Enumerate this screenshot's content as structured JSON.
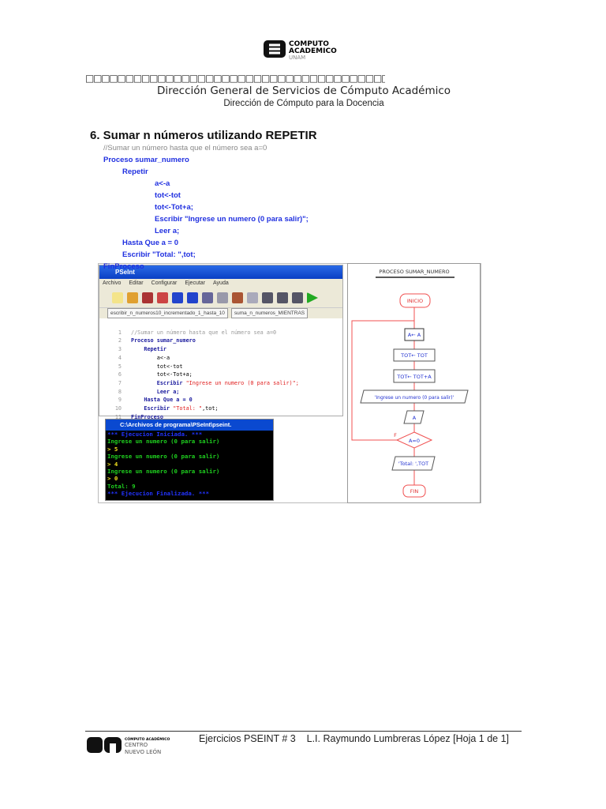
{
  "header": {
    "logo_lines": [
      "COMPUTO",
      "ACADEMICO",
      "UNAM"
    ],
    "boxes": "□□□□□□□□□□□□□□□□□□□□□□□□□□□□□□□□□□□□□□□□□□□□□□□□□□□□□□□□□□□□□□□□",
    "line1": "Dirección General de Servicios de Cómputo Académico",
    "line2": "Dirección de Cómputo para la Docencia"
  },
  "section": {
    "title": "6. Sumar n números utilizando REPETIR",
    "code": [
      "//Sumar un número hasta que el número sea a=0",
      "Proceso sumar_numero",
      "Repetir",
      "a<-a",
      "tot<-tot",
      "tot<-Tot+a;",
      "Escribir \"Ingrese un numero (0 para salir)\";",
      "Leer a;",
      "Hasta Que a = 0",
      "Escribir \"Total: \",tot;",
      "FinProceso"
    ]
  },
  "pseint": {
    "title": "PSeInt",
    "menu": [
      "Archivo",
      "Editar",
      "Configurar",
      "Ejecutar",
      "Ayuda"
    ],
    "tabs": [
      "escribir_n_numeros10_incrementado_1_hasta_10",
      "suma_n_numeros_MIENTRAS"
    ],
    "lines": [
      {
        "n": "1",
        "t": "//Sumar un número hasta que el número sea a=0"
      },
      {
        "n": "2",
        "t": "Proceso sumar_numero"
      },
      {
        "n": "3",
        "t": "Repetir"
      },
      {
        "n": "4",
        "t": "a<-a"
      },
      {
        "n": "5",
        "t": "tot<-tot"
      },
      {
        "n": "6",
        "t": "tot<-Tot+a;"
      },
      {
        "n": "7",
        "k": "Escribir",
        "s": "\"Ingrese un numero (0 para salir)\";"
      },
      {
        "n": "8",
        "t": "Leer a;"
      },
      {
        "n": "9",
        "t": "Hasta Que a = 0"
      },
      {
        "n": "10",
        "k": "Escribir",
        "s": "\"Total: \"",
        "r": ",tot;"
      },
      {
        "n": "11",
        "t": "FinProceso"
      }
    ]
  },
  "console": {
    "title": "C:\\Archivos de programa\\PSeInt\\pseint.",
    "lines": [
      "*** Ejecucion Iniciada. ***",
      "Ingrese un numero (0 para salir)",
      "> 5",
      "Ingrese un numero (0 para salir)",
      "> 4",
      "Ingrese un numero (0 para salir)",
      "> 0",
      "Total: 9",
      "*** Ejecucion Finalizada. ***"
    ]
  },
  "flowchart": {
    "title": "PROCESO SUMAR_NUMERO",
    "start": "INICIO",
    "a": "A← A",
    "tot1": "TOT← TOT",
    "tot2": "TOT← TOT+A",
    "out1": "'Ingrese un numero (0 para salir)'",
    "in": "A",
    "cond": "A=0",
    "false": "F",
    "out2": "'Total: ',TOT",
    "end": "FIN"
  },
  "footer": {
    "logo_lines": [
      "CÓMPUTO ACADÉMICO",
      "CENTRO",
      "NUEVO LEÓN"
    ],
    "text": "Ejercicios PSEINT # 3    L.I. Raymundo Lumbreras López [Hoja 1 de 1]"
  }
}
